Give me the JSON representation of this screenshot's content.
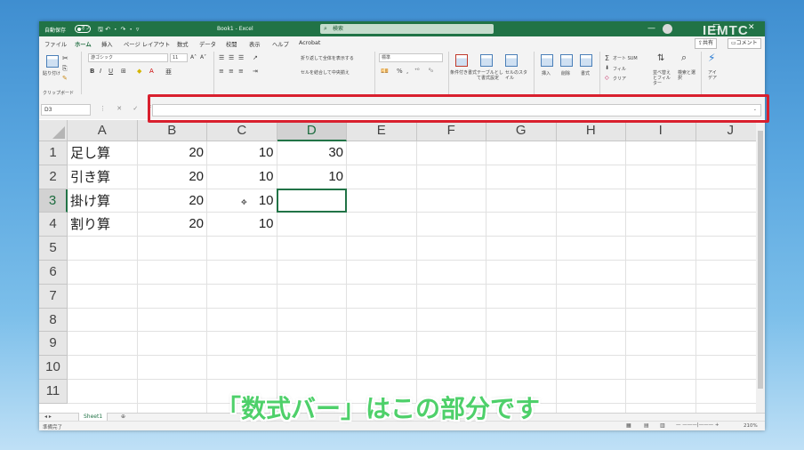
{
  "titlebar": {
    "autosave_label": "自動保存",
    "autosave_state": "オフ",
    "quick_icons": "🖫 ↶ ・ ↷ ・ ▿",
    "title": "Book1 - Excel",
    "search_placeholder": "検索",
    "minimize": "—",
    "maximize": "□",
    "close": "✕"
  },
  "menu": {
    "tabs": [
      "ファイル",
      "ホーム",
      "挿入",
      "ページ レイアウト",
      "数式",
      "データ",
      "校閲",
      "表示",
      "ヘルプ",
      "Acrobat"
    ],
    "active_tab": "ホーム",
    "share_label": "共有",
    "comment_label": "コメント"
  },
  "ribbon": {
    "paste_label": "貼り付け",
    "clipboard_label": "クリップボード",
    "font_name": "游ゴシック",
    "font_size": "11",
    "font_grow": "A˄",
    "font_shrink": "A˅",
    "bold": "B",
    "italic": "I",
    "underline": "U",
    "wrap_text": "折り返して全体を表示する",
    "merge_center": "セルを結合して中央揃え",
    "number_format": "標準",
    "conditional_format": "条件付き書式",
    "format_table": "テーブルとして書式設定",
    "cell_style": "セルのスタイル",
    "insert": "挿入",
    "delete": "削除",
    "format": "書式",
    "autosum": "オート SUM",
    "fill": "フィル",
    "clear": "クリア",
    "sort_filter": "並べ替えとフィルター",
    "find_select": "検索と選択",
    "ideas": "アイデア"
  },
  "formula_bar": {
    "name_box": "D3",
    "value": ""
  },
  "columns": [
    "A",
    "B",
    "C",
    "D",
    "E",
    "F",
    "G",
    "H",
    "I",
    "J"
  ],
  "selected_column": "D",
  "rows": [
    "1",
    "2",
    "3",
    "4",
    "5",
    "6",
    "7",
    "8",
    "9",
    "10",
    "11"
  ],
  "selected_row": "3",
  "cells": {
    "A1": "足し算",
    "B1": "20",
    "C1": "10",
    "D1": "30",
    "A2": "引き算",
    "B2": "20",
    "C2": "10",
    "D2": "10",
    "A3": "掛け算",
    "B3": "20",
    "C3": "10",
    "A4": "割り算",
    "B4": "20",
    "C4": "10"
  },
  "active_cell": "D3",
  "sheets": [
    "Sheet1"
  ],
  "status": {
    "ready": "準備完了",
    "zoom": "210%"
  },
  "caption": "「数式バー」はこの部分です",
  "watermark": "IEMTC"
}
